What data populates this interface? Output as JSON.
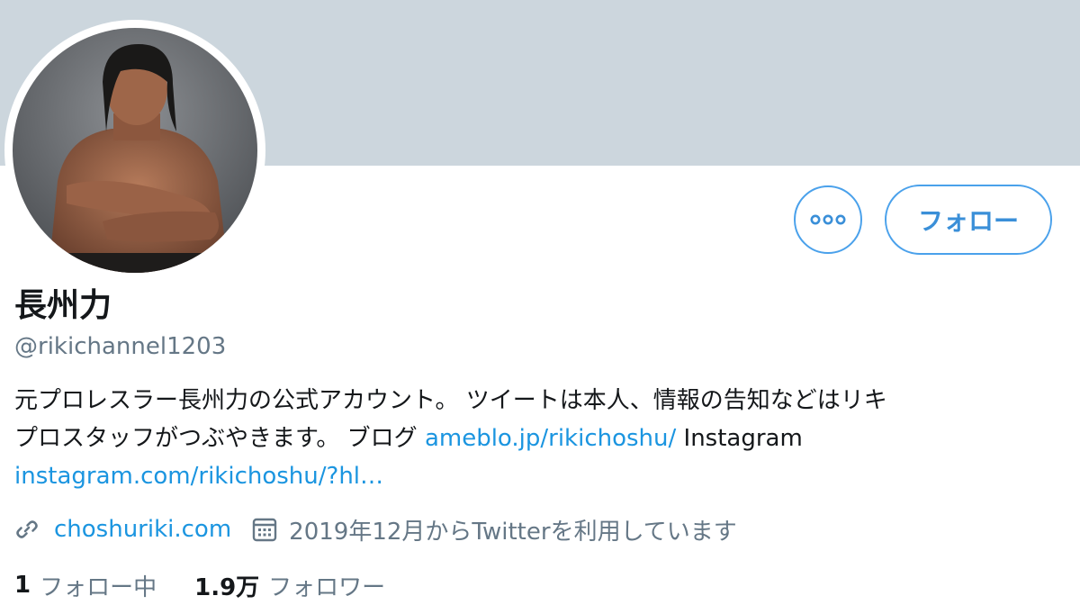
{
  "profile": {
    "display_name": "長州力",
    "handle": "@rikichannel1203",
    "bio_line1": "元プロレスラー長州力の公式アカウント。 ツイートは本人、情報の告知などはリキ",
    "bio_line2_text": "プロスタッフがつぶやきます。 ブログ ",
    "bio_link1": "ameblo.jp/rikichoshu/",
    "bio_line2_after": " Instagram",
    "bio_link2": "instagram.com/rikichoshu/?hl…",
    "website": "choshuriki.com",
    "joined": "2019年12月からTwitterを利用しています",
    "following_count": "1",
    "following_label": "フォロー中",
    "followers_count": "1.9万",
    "followers_label": "フォロワー"
  },
  "actions": {
    "follow_label": "フォロー",
    "more_icon": "more-dots-icon"
  },
  "icons": {
    "link": "link-icon",
    "calendar": "calendar-icon"
  },
  "colors": {
    "banner": "#ccd6dd",
    "accent": "#1b95e0",
    "secondary_text": "#657786"
  }
}
